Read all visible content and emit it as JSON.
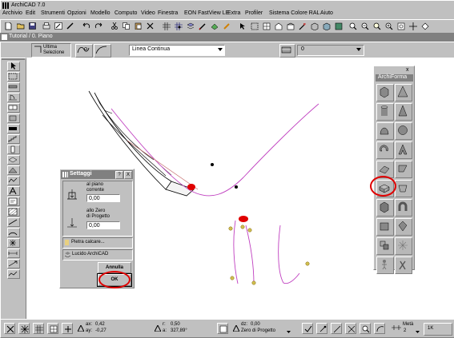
{
  "window": {
    "title": "ArchiCAD 7.0",
    "document_title": "Tutorial / 0. Piano"
  },
  "menu": [
    "Archivio",
    "Edit",
    "Strumenti",
    "Opzioni",
    "Modello",
    "Computo",
    "Video",
    "Finestra",
    "EON FastView LE",
    "Extra",
    "Profiler",
    "Sistema Colore RAL",
    "Aiuto"
  ],
  "infobox": {
    "selection_label_1": "Ultima",
    "selection_label_2": "Selezione",
    "line_type": "Linea Continua",
    "pen_value": "0"
  },
  "dialog": {
    "title": "Settaggi",
    "help_button": "?",
    "close_button": "X",
    "floor_label_1": "al piano",
    "floor_label_2": "corrente",
    "floor_value": "0,00",
    "zero_label_1": "allo Zero",
    "zero_label_2": "di Progetto",
    "zero_value": "0,00",
    "material": "Pietra calcare...",
    "layer": "Lucido ArchiCAD",
    "cancel_label": "Annulla",
    "ok_label": "OK"
  },
  "palette": {
    "title": "ArchiForma",
    "close": "x"
  },
  "statusbar": {
    "ax_label": "ax:",
    "ax_value": "0,42",
    "ay_label": "ay:",
    "ay_value": "-0,27",
    "r_label": "r:",
    "r_value": "0,50",
    "a_label": "a:",
    "a_value": "327,89°",
    "dz_label": "dz:",
    "dz_value": "0,00",
    "reference": "Zero di Progetto",
    "snap_label": "Metà",
    "snap_value": "2",
    "right_label": "1K"
  },
  "colors": {
    "highlight": "#e00000",
    "curve": "#c040c0",
    "sketch": "#000000"
  }
}
